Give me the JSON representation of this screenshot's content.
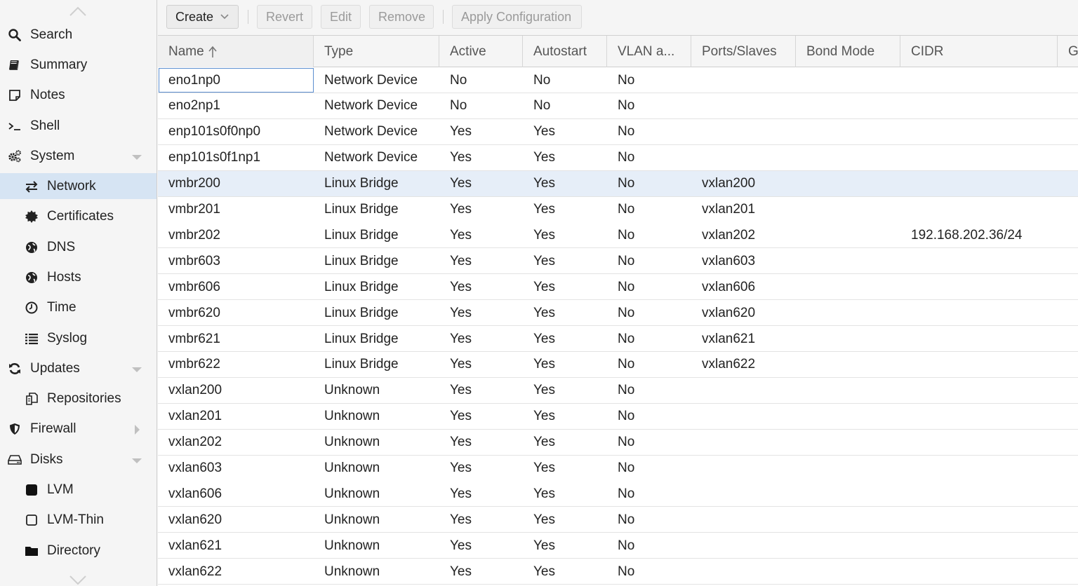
{
  "sidebar": {
    "items": [
      {
        "label": "Search",
        "icon": "search-icon",
        "level": 1
      },
      {
        "label": "Summary",
        "icon": "book-icon",
        "level": 1
      },
      {
        "label": "Notes",
        "icon": "note-icon",
        "level": 1
      },
      {
        "label": "Shell",
        "icon": "terminal-icon",
        "level": 1
      },
      {
        "label": "System",
        "icon": "gears-icon",
        "level": 1,
        "expander": "down"
      },
      {
        "label": "Network",
        "icon": "exchange-icon",
        "level": 2,
        "selected": true
      },
      {
        "label": "Certificates",
        "icon": "certificate-icon",
        "level": 2
      },
      {
        "label": "DNS",
        "icon": "globe-icon",
        "level": 2
      },
      {
        "label": "Hosts",
        "icon": "globe-icon",
        "level": 2
      },
      {
        "label": "Time",
        "icon": "clock-icon",
        "level": 2
      },
      {
        "label": "Syslog",
        "icon": "list-icon",
        "level": 2
      },
      {
        "label": "Updates",
        "icon": "refresh-icon",
        "level": 1,
        "expander": "down"
      },
      {
        "label": "Repositories",
        "icon": "files-icon",
        "level": 2
      },
      {
        "label": "Firewall",
        "icon": "shield-icon",
        "level": 1,
        "expander": "right"
      },
      {
        "label": "Disks",
        "icon": "hdd-icon",
        "level": 1,
        "expander": "down"
      },
      {
        "label": "LVM",
        "icon": "square-filled-icon",
        "level": 2
      },
      {
        "label": "LVM-Thin",
        "icon": "square-outline-icon",
        "level": 2
      },
      {
        "label": "Directory",
        "icon": "folder-icon",
        "level": 2
      }
    ]
  },
  "toolbar": {
    "create_label": "Create",
    "revert_label": "Revert",
    "edit_label": "Edit",
    "remove_label": "Remove",
    "apply_label": "Apply Configuration"
  },
  "grid": {
    "columns": [
      "Name",
      "Type",
      "Active",
      "Autostart",
      "VLAN a...",
      "Ports/Slaves",
      "Bond Mode",
      "CIDR",
      "G"
    ],
    "sort_column": "Name",
    "sort_direction": "ascending",
    "selected_row": "vmbr200",
    "focused_cell": "eno1np0",
    "rows": [
      [
        "eno1np0",
        "Network Device",
        "No",
        "No",
        "No",
        "",
        "",
        "",
        ""
      ],
      [
        "eno2np1",
        "Network Device",
        "No",
        "No",
        "No",
        "",
        "",
        "",
        ""
      ],
      [
        "enp101s0f0np0",
        "Network Device",
        "Yes",
        "Yes",
        "No",
        "",
        "",
        "",
        ""
      ],
      [
        "enp101s0f1np1",
        "Network Device",
        "Yes",
        "Yes",
        "No",
        "",
        "",
        "",
        ""
      ],
      [
        "vmbr200",
        "Linux Bridge",
        "Yes",
        "Yes",
        "No",
        "vxlan200",
        "",
        "",
        ""
      ],
      [
        "vmbr201",
        "Linux Bridge",
        "Yes",
        "Yes",
        "No",
        "vxlan201",
        "",
        "",
        ""
      ],
      [
        "vmbr202",
        "Linux Bridge",
        "Yes",
        "Yes",
        "No",
        "vxlan202",
        "",
        "192.168.202.36/24",
        ""
      ],
      [
        "vmbr603",
        "Linux Bridge",
        "Yes",
        "Yes",
        "No",
        "vxlan603",
        "",
        "",
        ""
      ],
      [
        "vmbr606",
        "Linux Bridge",
        "Yes",
        "Yes",
        "No",
        "vxlan606",
        "",
        "",
        ""
      ],
      [
        "vmbr620",
        "Linux Bridge",
        "Yes",
        "Yes",
        "No",
        "vxlan620",
        "",
        "",
        ""
      ],
      [
        "vmbr621",
        "Linux Bridge",
        "Yes",
        "Yes",
        "No",
        "vxlan621",
        "",
        "",
        ""
      ],
      [
        "vmbr622",
        "Linux Bridge",
        "Yes",
        "Yes",
        "No",
        "vxlan622",
        "",
        "",
        ""
      ],
      [
        "vxlan200",
        "Unknown",
        "Yes",
        "Yes",
        "No",
        "",
        "",
        "",
        ""
      ],
      [
        "vxlan201",
        "Unknown",
        "Yes",
        "Yes",
        "No",
        "",
        "",
        "",
        ""
      ],
      [
        "vxlan202",
        "Unknown",
        "Yes",
        "Yes",
        "No",
        "",
        "",
        "",
        ""
      ],
      [
        "vxlan603",
        "Unknown",
        "Yes",
        "Yes",
        "No",
        "",
        "",
        "",
        ""
      ],
      [
        "vxlan606",
        "Unknown",
        "Yes",
        "Yes",
        "No",
        "",
        "",
        "",
        ""
      ],
      [
        "vxlan620",
        "Unknown",
        "Yes",
        "Yes",
        "No",
        "",
        "",
        "",
        ""
      ],
      [
        "vxlan621",
        "Unknown",
        "Yes",
        "Yes",
        "No",
        "",
        "",
        "",
        ""
      ],
      [
        "vxlan622",
        "Unknown",
        "Yes",
        "Yes",
        "No",
        "",
        "",
        "",
        ""
      ]
    ]
  },
  "colors": {
    "selected_nav_bg": "#d6e4f3",
    "selected_row_bg": "#e6eef8",
    "focus_border": "#5b8ed0"
  }
}
